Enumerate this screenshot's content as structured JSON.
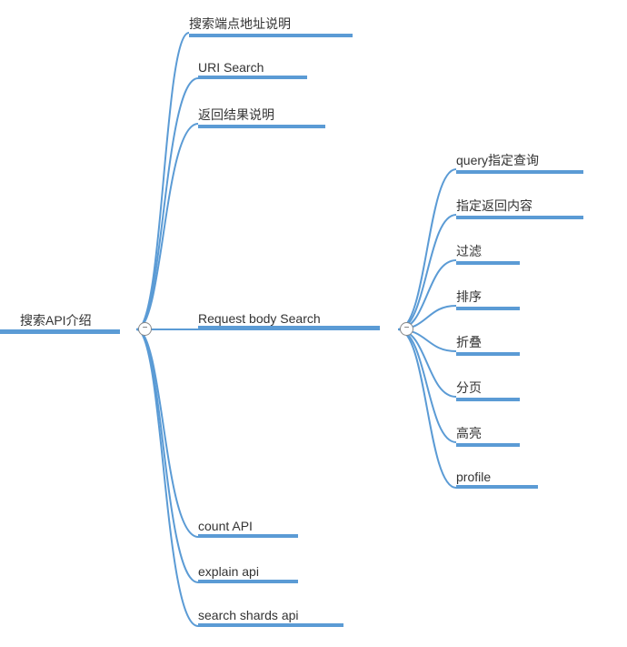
{
  "colors": {
    "line": "#5b9bd5"
  },
  "root": {
    "label": "搜索API介绍"
  },
  "level1": [
    {
      "label": "搜索端点地址说明"
    },
    {
      "label": "URI Search"
    },
    {
      "label": "返回结果说明"
    },
    {
      "label": "Request body Search"
    },
    {
      "label": "count API"
    },
    {
      "label": "explain api"
    },
    {
      "label": "search shards api"
    }
  ],
  "level2": [
    {
      "label": "query指定查询"
    },
    {
      "label": "指定返回内容"
    },
    {
      "label": "过滤"
    },
    {
      "label": "排序"
    },
    {
      "label": "折叠"
    },
    {
      "label": "分页"
    },
    {
      "label": "高亮"
    },
    {
      "label": "profile"
    }
  ],
  "toggles": {
    "root": "−",
    "body": "−"
  },
  "chart_data": {
    "type": "mindmap",
    "root": "搜索API介绍",
    "children": [
      {
        "name": "搜索端点地址说明"
      },
      {
        "name": "URI Search"
      },
      {
        "name": "返回结果说明"
      },
      {
        "name": "Request body Search",
        "children": [
          {
            "name": "query指定查询"
          },
          {
            "name": "指定返回内容"
          },
          {
            "name": "过滤"
          },
          {
            "name": "排序"
          },
          {
            "name": "折叠"
          },
          {
            "name": "分页"
          },
          {
            "name": "高亮"
          },
          {
            "name": "profile"
          }
        ]
      },
      {
        "name": "count API"
      },
      {
        "name": "explain api"
      },
      {
        "name": "search shards api"
      }
    ]
  }
}
